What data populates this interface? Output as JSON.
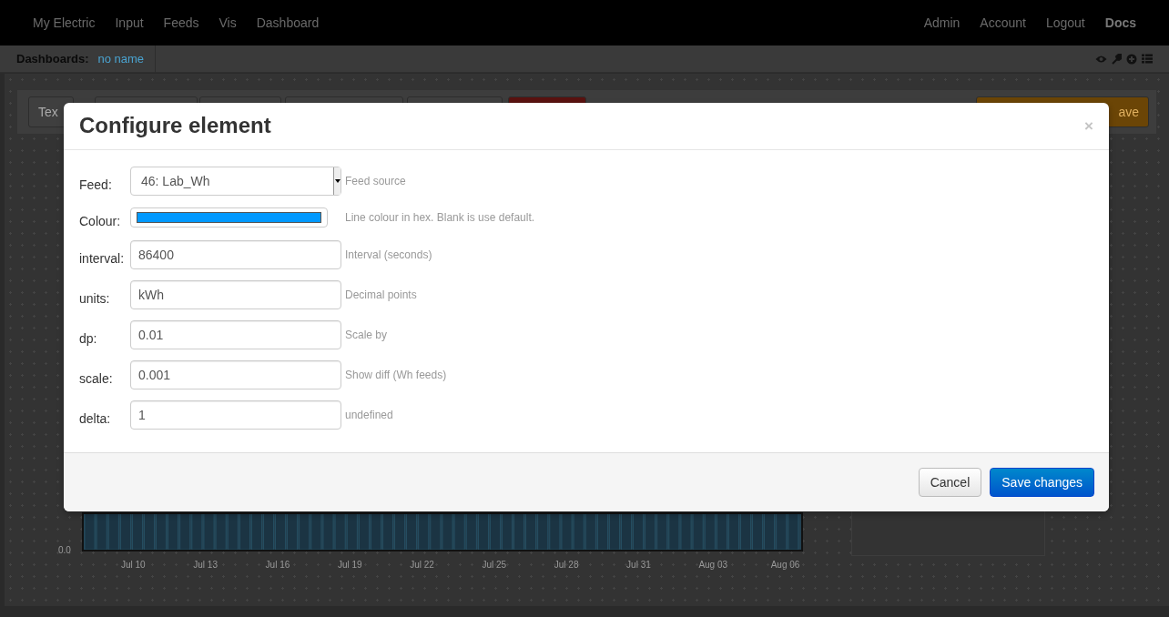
{
  "navbar": {
    "left_items": [
      {
        "label": "My Electric",
        "emphasized": false
      },
      {
        "label": "Input",
        "emphasized": false
      },
      {
        "label": "Feeds",
        "emphasized": false
      },
      {
        "label": "Vis",
        "emphasized": false
      },
      {
        "label": "Dashboard",
        "emphasized": false
      }
    ],
    "right_items": [
      {
        "label": "Admin",
        "emphasized": false
      },
      {
        "label": "Account",
        "emphasized": false
      },
      {
        "label": "Logout",
        "emphasized": false
      },
      {
        "label": "Docs",
        "emphasized": true
      }
    ]
  },
  "dashboard_bar": {
    "label": "Dashboards:",
    "dashboard_name": "no name"
  },
  "toolbar": {
    "left_buttons": [
      {
        "label": "Tex",
        "kind": "light"
      },
      {
        "kind": "light"
      },
      {
        "kind": "light"
      },
      {
        "kind": "light"
      },
      {
        "kind": "light"
      },
      {
        "kind": "danger"
      }
    ],
    "right_buttons": [
      {
        "label": "ave",
        "kind": "warning"
      }
    ]
  },
  "background_chart": {
    "y_label": "0.0",
    "x_labels": [
      "Jul 10",
      "Jul 13",
      "Jul 16",
      "Jul 19",
      "Jul 22",
      "Jul 25",
      "Jul 28",
      "Jul 31",
      "Aug 03",
      "Aug 06"
    ]
  },
  "modal": {
    "title": "Configure element",
    "close": "×",
    "fields": [
      {
        "label": "Feed:",
        "kind": "select",
        "value": "46: Lab_Wh",
        "help": "Feed source"
      },
      {
        "label": "Colour:",
        "kind": "color",
        "color": "#0099ff",
        "help": "Line colour in hex. Blank is use default."
      },
      {
        "label": "interval:",
        "kind": "text",
        "value": "86400",
        "help": "Interval (seconds)"
      },
      {
        "label": "units:",
        "kind": "text",
        "value": "kWh",
        "help": "Decimal points"
      },
      {
        "label": "dp:",
        "kind": "text",
        "value": "0.01",
        "help": "Scale by"
      },
      {
        "label": "scale:",
        "kind": "text",
        "value": "0.001",
        "help": "Show diff (Wh feeds)"
      },
      {
        "label": "delta:",
        "kind": "text",
        "value": "1",
        "help": "undefined"
      }
    ],
    "buttons": [
      {
        "label": "Cancel",
        "kind": "secondary"
      },
      {
        "label": "Save changes",
        "kind": "primary"
      }
    ]
  }
}
